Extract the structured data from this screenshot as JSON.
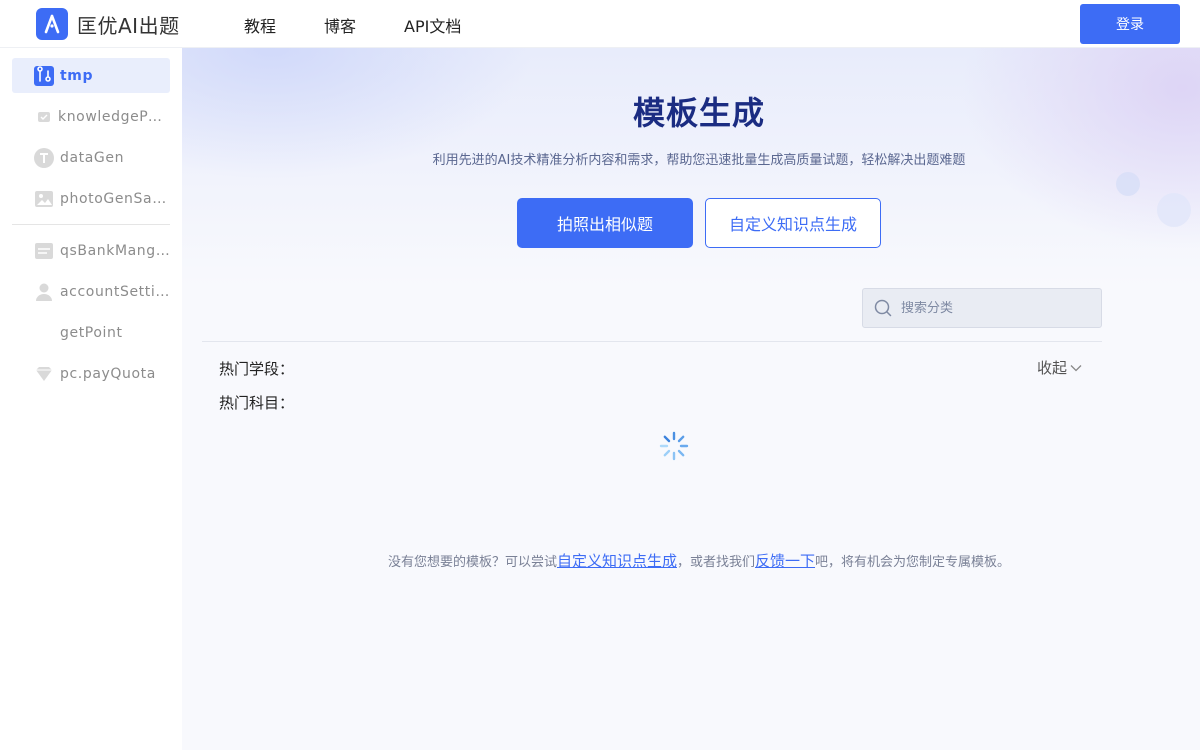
{
  "header": {
    "logo_text": "匡优AI出题",
    "nav": [
      "教程",
      "博客",
      "API文档"
    ],
    "login_label": "登录"
  },
  "sidebar": {
    "items": [
      {
        "label": "tmp",
        "icon": "template-icon",
        "active": true
      },
      {
        "label": "knowledgePoint",
        "icon": "knowledge-icon"
      },
      {
        "label": "dataGen",
        "icon": "text-t-icon"
      },
      {
        "label": "photoGenSample",
        "icon": "image-icon"
      },
      {
        "label": "qsBankManger",
        "icon": "question-bank-icon"
      },
      {
        "label": "accountSetting",
        "icon": "user-icon"
      },
      {
        "label": "getPoint",
        "icon": "none"
      },
      {
        "label": "pc.payQuota",
        "icon": "diamond-icon"
      }
    ]
  },
  "main": {
    "title": "模板生成",
    "subtitle": "利用先进的AI技术精准分析内容和需求，帮助您迅速批量生成高质量试题，轻松解决出题难题",
    "photo_button": "拍照出相似题",
    "custom_button": "自定义知识点生成",
    "search_placeholder": "搜索分类",
    "hot_stage_label": "热门学段：",
    "hot_subject_label": "热门科目：",
    "collapse_label": "收起",
    "bottom_note": {
      "prefix": "没有您想要的模板？可以尝试",
      "link1": "自定义知识点生成",
      "middle": "，或者找我们",
      "link2": "反馈一下",
      "suffix": "吧，将有机会为您制定专属模板。"
    }
  },
  "colors": {
    "accent": "#3d6cf5",
    "title": "#1b2c82",
    "sidebar_active_bg": "#e9eefc"
  }
}
